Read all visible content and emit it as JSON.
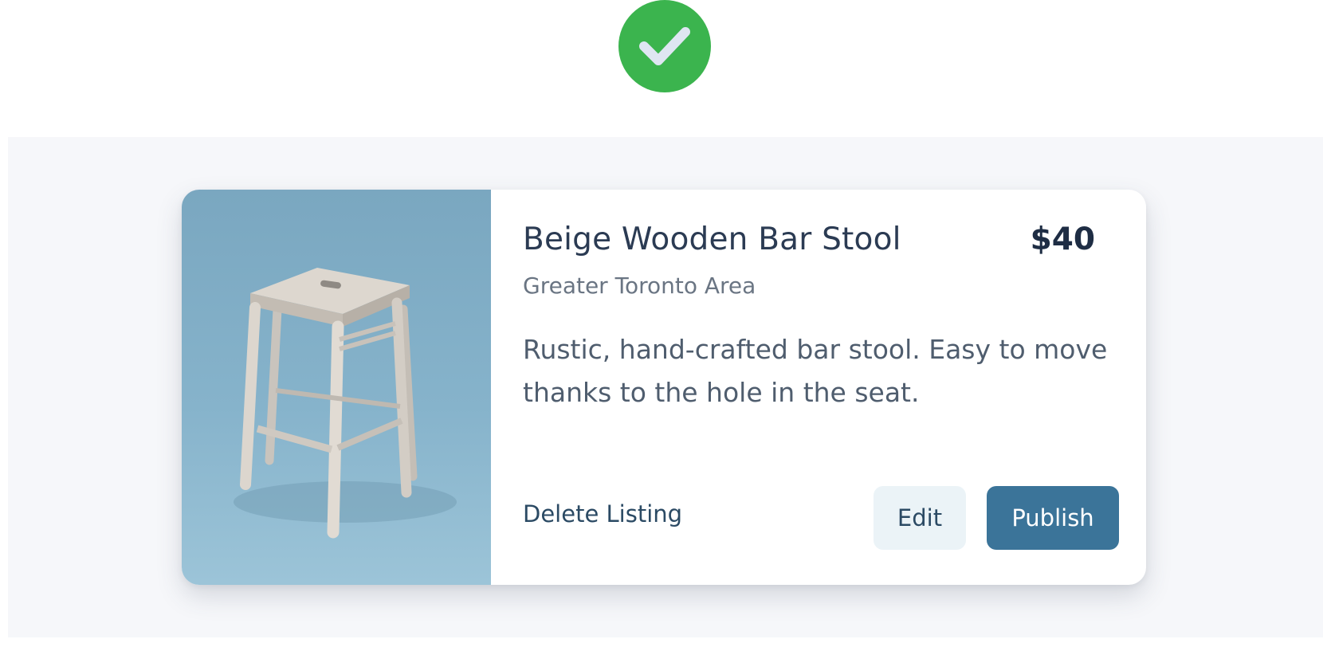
{
  "status": {
    "icon": "check-circle-icon",
    "color": "#3bb44e"
  },
  "listing": {
    "image": {
      "subject": "stool-photo",
      "background": "#86b3cb"
    },
    "title": "Beige Wooden Bar Stool",
    "price": "$40",
    "location": "Greater Toronto Area",
    "description": "Rustic, hand-crafted bar stool. Easy to move thanks to the hole in the seat."
  },
  "actions": {
    "delete_label": "Delete Listing",
    "edit_label": "Edit",
    "publish_label": "Publish",
    "publish_color": "#3b7499"
  }
}
